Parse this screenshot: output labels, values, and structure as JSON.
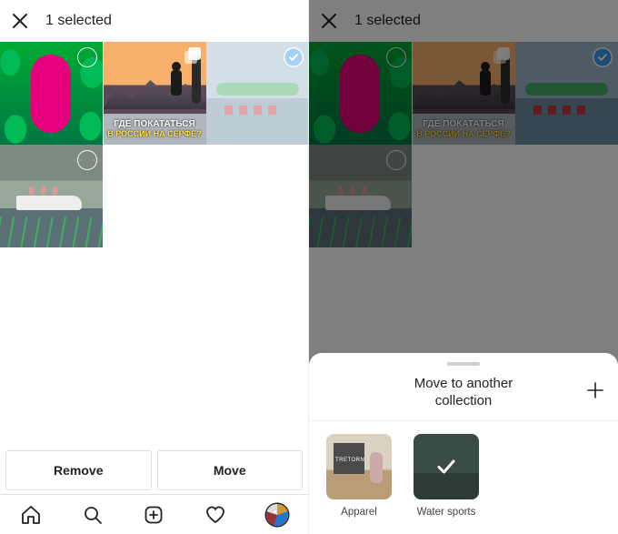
{
  "left": {
    "header_title": "1 selected",
    "thumb2_caption_line1": "ГДЕ ПОКАТАТЬСЯ",
    "thumb2_caption_line2": "В РОССИИ НА СЕРФЕ?",
    "actions": {
      "remove": "Remove",
      "move": "Move"
    }
  },
  "right": {
    "header_title": "1 selected",
    "thumb2_caption_line1": "ГДЕ ПОКАТАТЬСЯ",
    "thumb2_caption_line2": "В РОССИИ НА СЕРФЕ?",
    "sheet": {
      "title_line1": "Move to another",
      "title_line2": "collection",
      "collections": [
        {
          "label": "Apparel",
          "selected": false
        },
        {
          "label": "Water sports",
          "selected": true
        }
      ]
    }
  }
}
